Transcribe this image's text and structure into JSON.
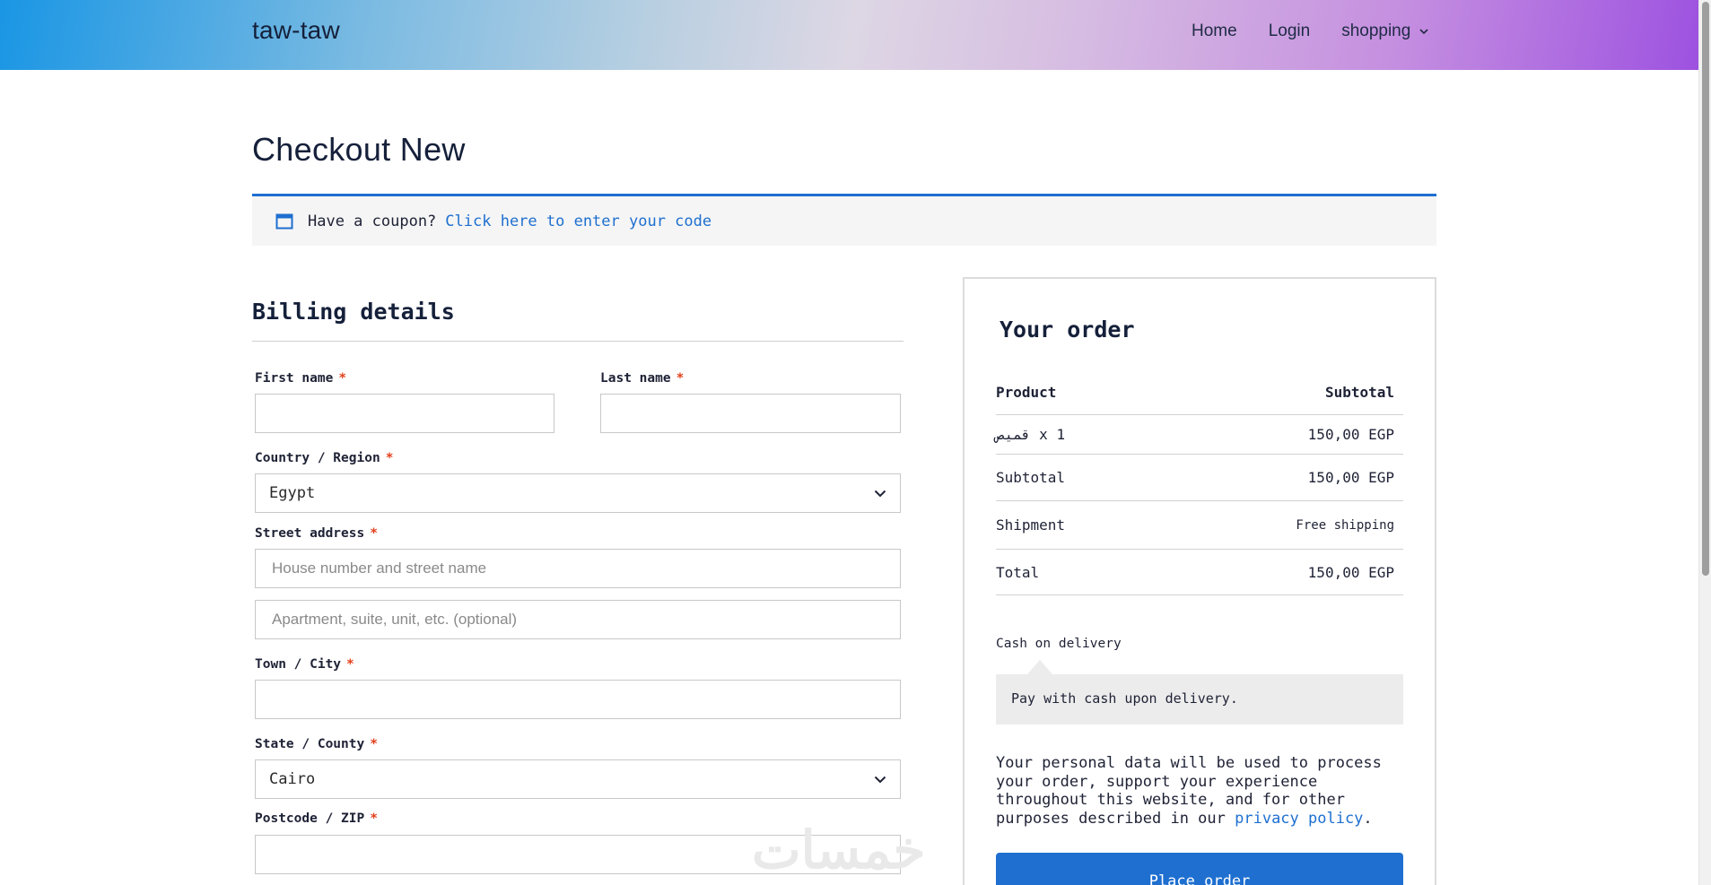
{
  "header": {
    "site_title": "taw-taw",
    "nav": [
      {
        "label": "Home"
      },
      {
        "label": "Login"
      },
      {
        "label": "shopping",
        "icon": "chevron-down-icon"
      }
    ]
  },
  "page": {
    "title": "Checkout New"
  },
  "coupon": {
    "icon": "window-icon",
    "text": "Have a coupon?",
    "link": "Click here to enter your code"
  },
  "billing": {
    "heading": "Billing details",
    "required_mark": "*",
    "first_name": {
      "label": "First name",
      "value": ""
    },
    "last_name": {
      "label": "Last name",
      "value": ""
    },
    "country": {
      "label": "Country / Region",
      "value": "Egypt"
    },
    "street": {
      "label": "Street address",
      "placeholder_1": "House number and street name",
      "placeholder_2": "Apartment, suite, unit, etc. (optional)"
    },
    "city": {
      "label": "Town / City",
      "value": ""
    },
    "state": {
      "label": "State / County",
      "value": "Cairo"
    },
    "postcode": {
      "label": "Postcode / ZIP",
      "value": ""
    }
  },
  "order": {
    "heading": "Your order",
    "columns": {
      "product": "Product",
      "subtotal": "Subtotal"
    },
    "item": {
      "name": "قميص",
      "qty": "x 1",
      "price": "150,00 EGP"
    },
    "subtotal": {
      "label": "Subtotal",
      "value": "150,00 EGP"
    },
    "shipment": {
      "label": "Shipment",
      "value": "Free shipping"
    },
    "total": {
      "label": "Total",
      "value": "150,00 EGP"
    },
    "payment": {
      "method": "Cash on delivery",
      "description": "Pay with cash upon delivery."
    },
    "privacy": {
      "text": "Your personal data will be used to process your order, support your experience throughout this website, and for other purposes described in our",
      "link": "privacy policy",
      "end": "."
    },
    "place_order": "Place order"
  },
  "watermark": "خمسات",
  "colors": {
    "accent": "#1e6fd0",
    "required": "#e2401c",
    "header_gradient_start": "#1a96e4",
    "header_gradient_end": "#9d52e0"
  }
}
